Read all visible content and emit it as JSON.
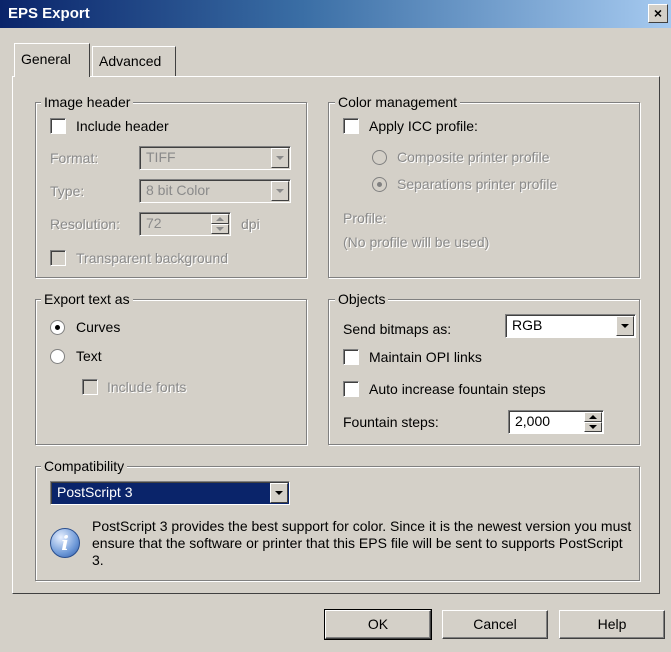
{
  "window": {
    "title": "EPS Export",
    "close_glyph": "×"
  },
  "tabs": [
    {
      "label": "General",
      "active": true
    },
    {
      "label": "Advanced",
      "active": false
    }
  ],
  "image_header": {
    "legend": "Image header",
    "include_header": {
      "label": "Include header",
      "checked": false
    },
    "format": {
      "label": "Format:",
      "value": "TIFF"
    },
    "type": {
      "label": "Type:",
      "value": "8 bit Color"
    },
    "resolution": {
      "label": "Resolution:",
      "value": "72",
      "unit": "dpi"
    },
    "transparent_background": {
      "label": "Transparent background",
      "checked": false
    }
  },
  "color_management": {
    "legend": "Color management",
    "apply_icc": {
      "label": "Apply ICC profile:",
      "checked": false
    },
    "composite": {
      "label": "Composite printer profile",
      "selected": false
    },
    "separations": {
      "label": "Separations printer profile",
      "selected": true
    },
    "profile_label": "Profile:",
    "profile_value": "(No profile will be used)"
  },
  "export_text": {
    "legend": "Export text as",
    "curves": {
      "label": "Curves",
      "selected": true
    },
    "text": {
      "label": "Text",
      "selected": false
    },
    "include_fonts": {
      "label": "Include fonts",
      "checked": false
    }
  },
  "objects": {
    "legend": "Objects",
    "send_bitmaps_label": "Send bitmaps as:",
    "send_bitmaps_value": "RGB",
    "maintain_opi": {
      "label": "Maintain OPI links",
      "checked": false
    },
    "auto_increase": {
      "label": "Auto increase fountain steps",
      "checked": false
    },
    "fountain_steps_label": "Fountain steps:",
    "fountain_steps_value": "2,000"
  },
  "compatibility": {
    "legend": "Compatibility",
    "value": "PostScript 3",
    "info_glyph": "i",
    "info_text": "PostScript 3 provides the best support for color. Since it is the newest version you must ensure that the software or printer that this EPS file will be sent to supports PostScript 3."
  },
  "buttons": {
    "ok": "OK",
    "cancel": "Cancel",
    "help": "Help"
  }
}
